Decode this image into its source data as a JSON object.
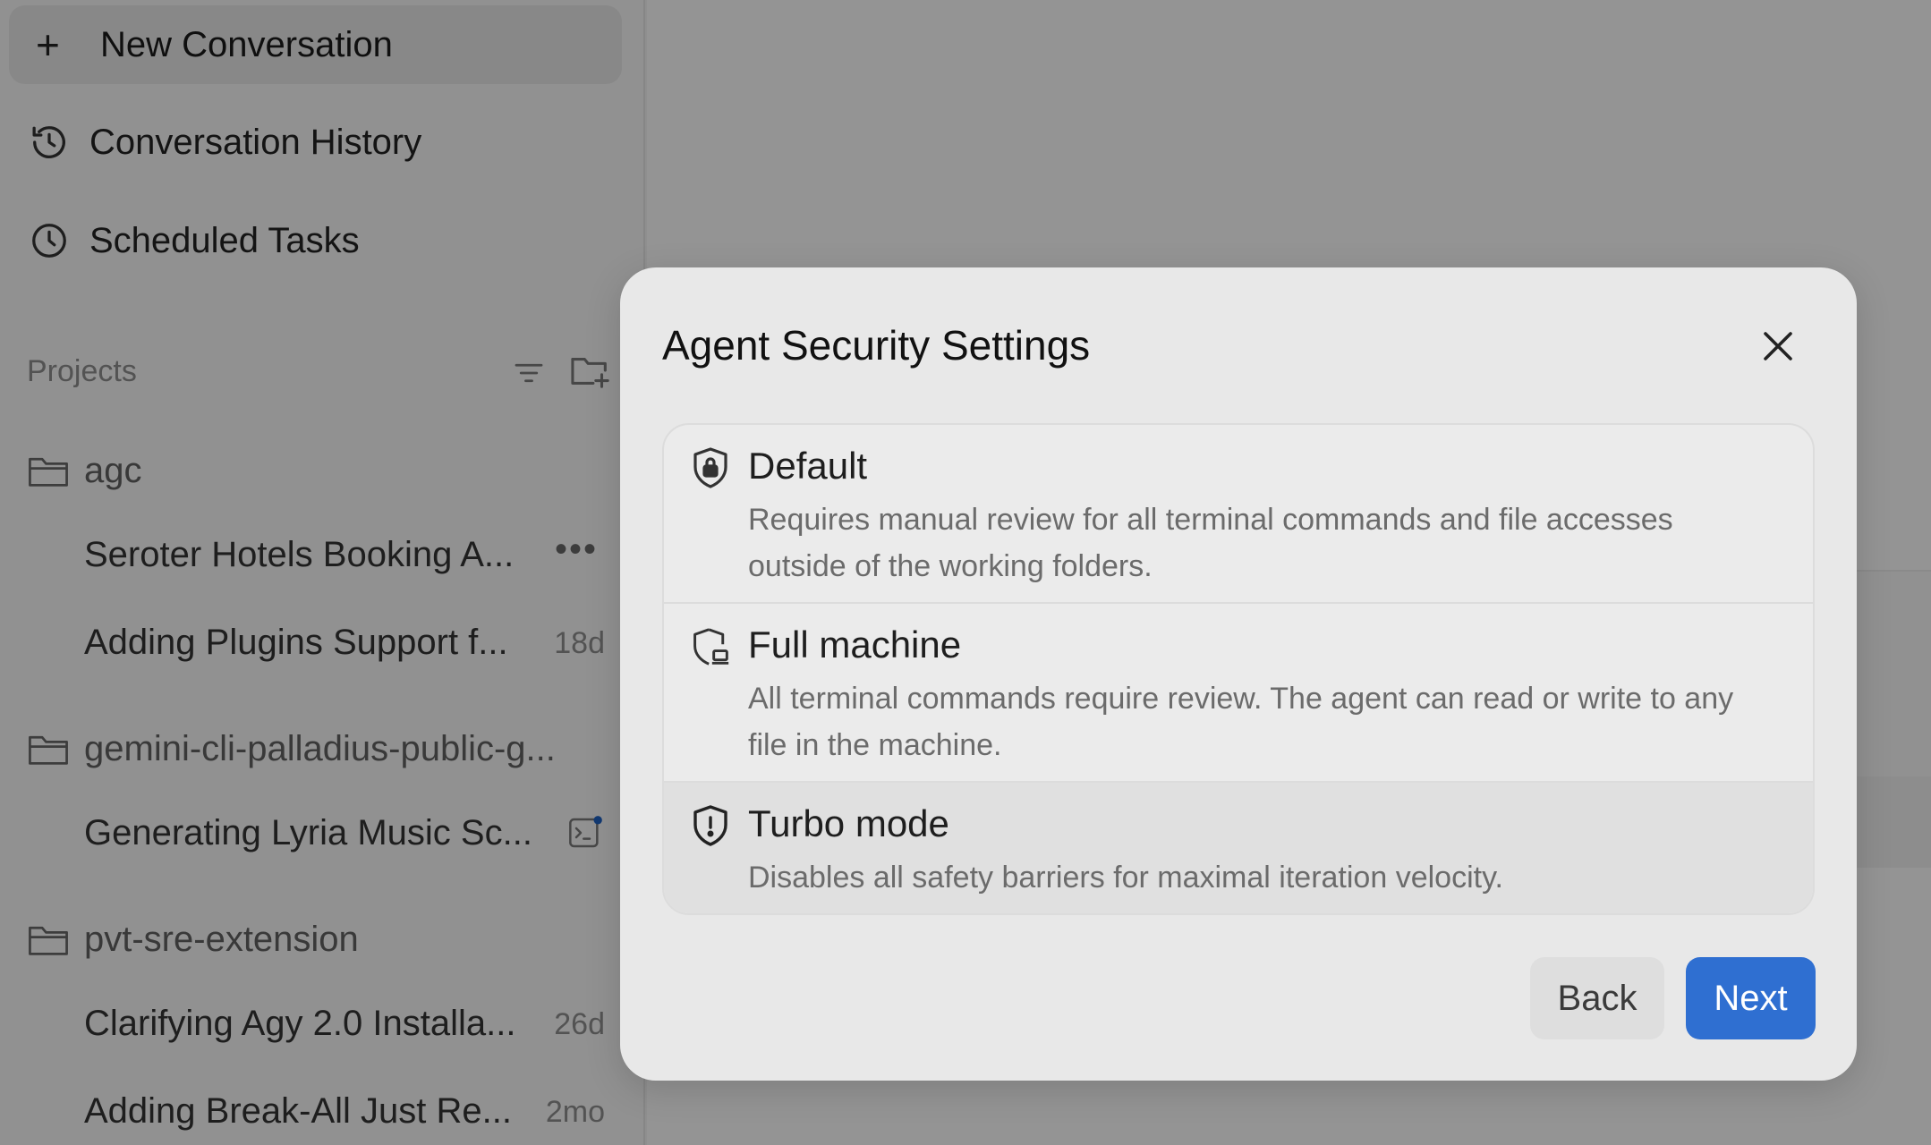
{
  "sidebar": {
    "new_conversation": "New Conversation",
    "nav": {
      "history": "Conversation History",
      "scheduled": "Scheduled Tasks"
    },
    "projects_label": "Projects",
    "projects": [
      {
        "name": "agc",
        "conversations": [
          {
            "title": "Seroter Hotels Booking A...",
            "meta": "•••"
          },
          {
            "title": "Adding Plugins Support f...",
            "meta": "18d"
          }
        ]
      },
      {
        "name": "gemini-cli-palladius-public-g...",
        "conversations": [
          {
            "title": "Generating Lyria Music Sc...",
            "meta": ""
          }
        ]
      },
      {
        "name": "pvt-sre-extension",
        "conversations": [
          {
            "title": "Clarifying Agy 2.0 Installa...",
            "meta": "26d"
          },
          {
            "title": "Adding Break-All Just Re...",
            "meta": "2mo"
          }
        ]
      }
    ]
  },
  "modal": {
    "title": "Agent Security Settings",
    "options": [
      {
        "name": "Default",
        "description": "Requires manual review for all terminal commands and file accesses outside of the working folders."
      },
      {
        "name": "Full machine",
        "description": "All terminal commands require review. The agent can read or write to any file in the machine."
      },
      {
        "name": "Turbo mode",
        "description": "Disables all safety barriers for maximal iteration velocity."
      }
    ],
    "back_label": "Back",
    "next_label": "Next"
  },
  "colors": {
    "accent": "#2f6fd1",
    "notification_dot": "#1f5fbf"
  }
}
